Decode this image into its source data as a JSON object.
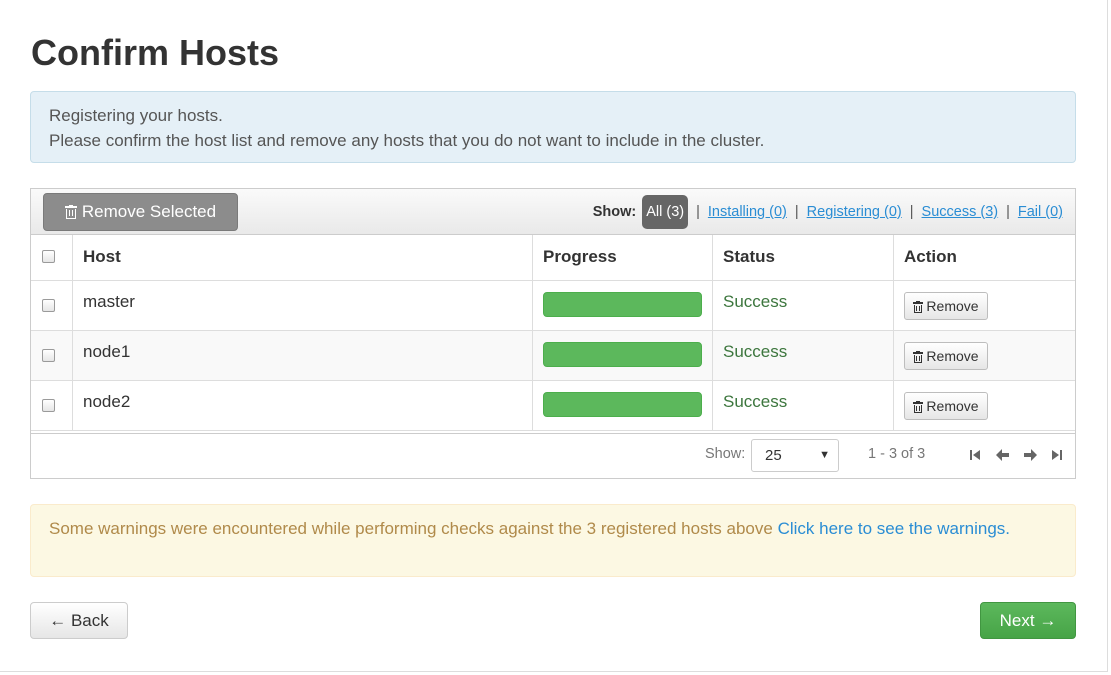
{
  "page": {
    "title": "Confirm Hosts"
  },
  "info": {
    "line1": "Registering your hosts.",
    "line2": "Please confirm the host list and remove any hosts that you do not want to include in the cluster."
  },
  "toolbar": {
    "remove_selected_label": "Remove Selected",
    "remove_selected_icon": "trash-icon",
    "filter": {
      "show_label": "Show:",
      "active": "All (3)",
      "links": [
        "Installing (0)",
        "Registering (0)",
        "Success (3)",
        "Fail (0)"
      ],
      "separator": "|"
    }
  },
  "table": {
    "columns": [
      "Host",
      "Progress",
      "Status",
      "Action"
    ],
    "rows": [
      {
        "host": "master",
        "progress": 1.0,
        "status": "Success",
        "action": "Remove"
      },
      {
        "host": "node1",
        "progress": 1.0,
        "status": "Success",
        "action": "Remove"
      },
      {
        "host": "node2",
        "progress": 1.0,
        "status": "Success",
        "action": "Remove"
      }
    ]
  },
  "pager": {
    "show_label": "Show:",
    "page_size": "25",
    "range": "1 - 3 of 3",
    "icons": [
      "first-page-icon",
      "previous-page-icon",
      "next-page-icon",
      "last-page-icon"
    ]
  },
  "warning": {
    "text": "Some warnings were encountered while performing checks against the 3 registered hosts above",
    "link": "Click here to see the warnings."
  },
  "nav": {
    "back_label": "← Back",
    "next_label": "Next →"
  },
  "colors": {
    "success": "#3c763d",
    "progress_bar": "#5cb85c",
    "link": "#2a8dd4",
    "next_button": "#5cb85c"
  }
}
